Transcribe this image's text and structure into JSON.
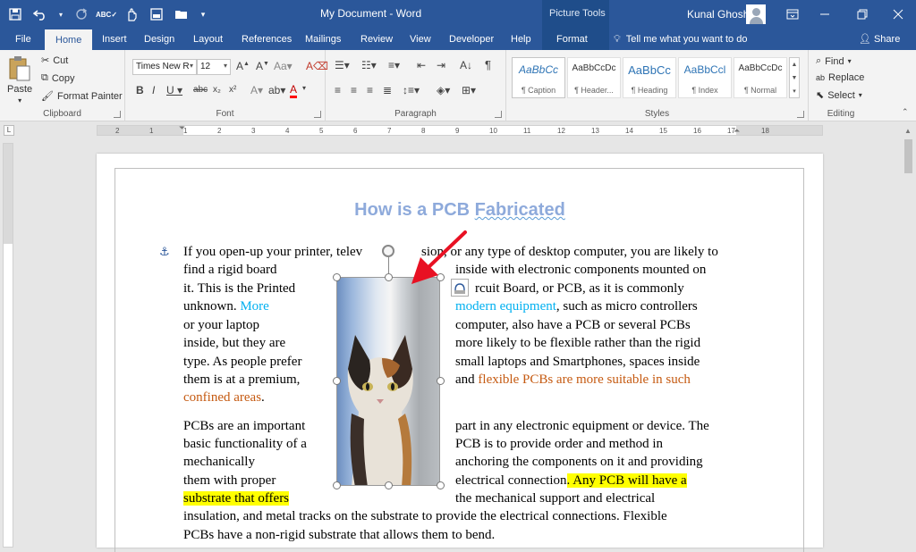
{
  "title_bar": {
    "document_title": "My Document  -  Word",
    "contextual_tools": "Picture Tools",
    "user_name": "Kunal Ghosh",
    "quick_access": [
      "save-icon",
      "undo-icon",
      "redo-icon",
      "spelling-icon",
      "touch-mode-icon",
      "print-preview-icon",
      "open-icon",
      "customize-icon"
    ]
  },
  "tabs": [
    "File",
    "Home",
    "Insert",
    "Design",
    "Layout",
    "References",
    "Mailings",
    "Review",
    "View",
    "Developer",
    "Help",
    "Format"
  ],
  "active_tab": "Home",
  "tell_me": "Tell me what you want to do",
  "share": "Share",
  "clipboard": {
    "paste": "Paste",
    "cut": "Cut",
    "copy": "Copy",
    "format_painter": "Format Painter",
    "label": "Clipboard"
  },
  "font": {
    "name": "Times New R",
    "size": "12",
    "label": "Font"
  },
  "paragraph": {
    "label": "Paragraph"
  },
  "styles": {
    "label": "Styles",
    "items": [
      {
        "preview": "AaBbCc",
        "name": "¶ Caption"
      },
      {
        "preview": "AaBbCcDc",
        "name": "¶ Header..."
      },
      {
        "preview": "AaBbCc",
        "name": "¶ Heading"
      },
      {
        "preview": "AaBbCcl",
        "name": "¶ Index"
      },
      {
        "preview": "AaBbCcDc",
        "name": "¶ Normal"
      }
    ]
  },
  "editing": {
    "find": "Find",
    "replace": "Replace",
    "select": "Select",
    "label": "Editing"
  },
  "ruler": {
    "marks": [
      "2",
      "1",
      "1",
      "2",
      "3",
      "4",
      "5",
      "6",
      "7",
      "8",
      "9",
      "10",
      "11",
      "12",
      "13",
      "14",
      "15",
      "16",
      "17",
      "18"
    ]
  },
  "document": {
    "heading_a": "How is a PCB ",
    "heading_b": "Fabricated",
    "lines": [
      {
        "left": "If you open-up your printer, telev",
        "right": "sion, or any type of desktop computer, you are likely to"
      },
      {
        "left": "find a rigid board",
        "right": "inside with electronic components mounted on"
      },
      {
        "left": "it. This is the Printed",
        "right": "rcuit Board, or PCB, as it is commonly"
      },
      {
        "left_a": "unknown. ",
        "left_b": "More",
        "right_a": "modern equipment",
        "right_b": ", such as micro controllers"
      },
      {
        "left": "or your laptop",
        "right": "computer, also have a PCB or several PCBs"
      },
      {
        "left": "inside, but they are",
        "right": "more likely to be flexible rather than the rigid"
      },
      {
        "left": "type. As people prefer",
        "right": "small laptops and Smartphones, spaces inside"
      },
      {
        "left": "them is at a premium,",
        "right_a": "and ",
        "right_b": "flexible PCBs are more suitable in such"
      },
      {
        "left_a": "confined areas",
        "left_b": "."
      }
    ],
    "para2": [
      {
        "left": "PCBs are an important",
        "right": "part in any electronic equipment or device. The"
      },
      {
        "left": "basic functionality of a",
        "right": "PCB is to provide order and method in"
      },
      {
        "left": "mechanically",
        "right": "anchoring the components on it and providing"
      },
      {
        "left": "them with proper",
        "right_a": "electrical connection",
        "right_b": ". Any PCB will have a"
      },
      {
        "left": "substrate that offers",
        "right": "the mechanical support and electrical"
      },
      {
        "full": "insulation, and metal tracks on the substrate to provide the electrical connections. Flexible"
      },
      {
        "full": "PCBs have a non-rigid substrate that allows them to bend."
      }
    ]
  },
  "colors": {
    "accent": "#2b579a",
    "heading": "#8eaadb",
    "link_blue": "#00b0f0",
    "orange": "#c55a11",
    "highlight": "#ffff00"
  }
}
